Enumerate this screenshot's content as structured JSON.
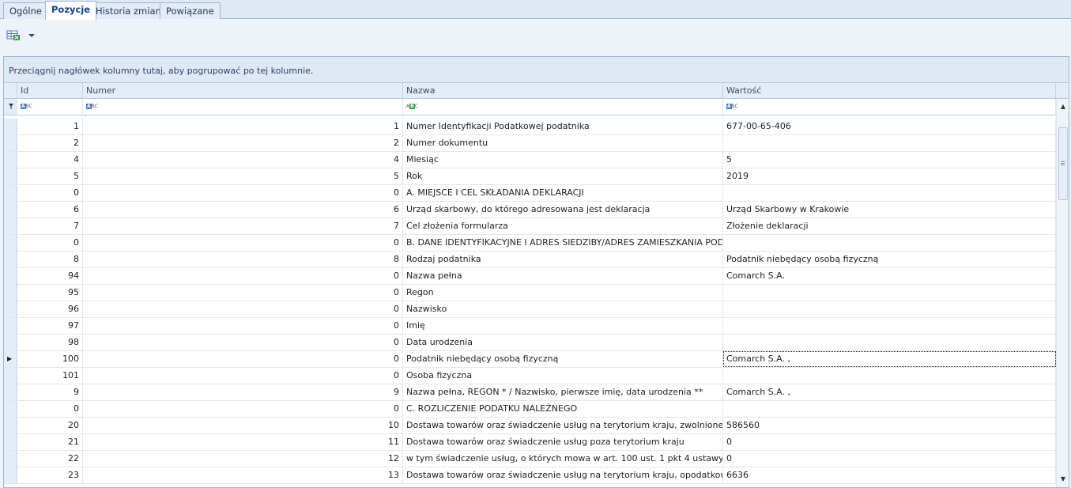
{
  "tabs": [
    {
      "label": "Ogólne"
    },
    {
      "label": "Pozycje"
    },
    {
      "label": "Historia zmian"
    },
    {
      "label": "Powiązane"
    }
  ],
  "toolbar": {
    "export_icon": "export-to-excel-icon",
    "dropdown_icon": "chevron-down-icon"
  },
  "grid": {
    "group_panel_text": "Przeciągnij nagłówek kolumny tutaj, aby pogrupować po tej kolumnie.",
    "columns": {
      "id": "Id",
      "numer": "Numer",
      "nazwa": "Nazwa",
      "wartosc": "Wartość"
    },
    "rows": [
      {
        "id": "1",
        "numer": "1",
        "nazwa": "Numer Identyfikacji Podatkowej podatnika",
        "wartosc": "677-00-65-406"
      },
      {
        "id": "2",
        "numer": "2",
        "nazwa": "Numer dokumentu",
        "wartosc": ""
      },
      {
        "id": "4",
        "numer": "4",
        "nazwa": "Miesiąc",
        "wartosc": "5"
      },
      {
        "id": "5",
        "numer": "5",
        "nazwa": "Rok",
        "wartosc": "2019"
      },
      {
        "id": "0",
        "numer": "0",
        "nazwa": "A. MIEJSCE I CEL SKŁADANIA DEKLARACJI",
        "wartosc": ""
      },
      {
        "id": "6",
        "numer": "6",
        "nazwa": "Urząd skarbowy, do którego adresowana jest deklaracja",
        "wartosc": "Urząd Skarbowy w Krakowie"
      },
      {
        "id": "7",
        "numer": "7",
        "nazwa": "Cel złożenia formularza",
        "wartosc": "Złożenie deklaracji"
      },
      {
        "id": "0",
        "numer": "0",
        "nazwa": "B. DANE IDENTYFIKACYJNE I ADRES SIEDZIBY/ADRES ZAMIESZKANIA PODATNI...",
        "wartosc": ""
      },
      {
        "id": "8",
        "numer": "8",
        "nazwa": "Rodzaj podatnika",
        "wartosc": "Podatnik niebędący osobą fizyczną"
      },
      {
        "id": "94",
        "numer": "0",
        "nazwa": "Nazwa pełna",
        "wartosc": "Comarch S.A."
      },
      {
        "id": "95",
        "numer": "0",
        "nazwa": "Regon",
        "wartosc": ""
      },
      {
        "id": "96",
        "numer": "0",
        "nazwa": "Nazwisko",
        "wartosc": ""
      },
      {
        "id": "97",
        "numer": "0",
        "nazwa": "Imię",
        "wartosc": ""
      },
      {
        "id": "98",
        "numer": "0",
        "nazwa": "Data urodzenia",
        "wartosc": ""
      },
      {
        "id": "100",
        "numer": "0",
        "nazwa": "Podatnik niebędący osobą fizyczną",
        "wartosc": "Comarch S.A. ,"
      },
      {
        "id": "101",
        "numer": "0",
        "nazwa": "Osoba fizyczna",
        "wartosc": ""
      },
      {
        "id": "9",
        "numer": "9",
        "nazwa": "Nazwa pełna, REGON * / Nazwisko, pierwsze imię, data  urodzenia **",
        "wartosc": "Comarch S.A. ,"
      },
      {
        "id": "0",
        "numer": "0",
        "nazwa": "C. ROZLICZENIE PODATKU NALEŻNEGO",
        "wartosc": ""
      },
      {
        "id": "20",
        "numer": "10",
        "nazwa": "Dostawa towarów oraz świadczenie usług na terytorium kraju, zwolnione o...",
        "wartosc": "586560"
      },
      {
        "id": "21",
        "numer": "11",
        "nazwa": "Dostawa towarów oraz świadczenie usług poza terytorium  kraju",
        "wartosc": "0"
      },
      {
        "id": "22",
        "numer": "12",
        "nazwa": "w tym świadczenie usług, o których mowa w art. 100 ust. 1 pkt 4 ustawy",
        "wartosc": "0"
      },
      {
        "id": "23",
        "numer": "13",
        "nazwa": "Dostawa towarów oraz świadczenie usług na terytorium kraju, opodatkow...",
        "wartosc": "6636"
      }
    ]
  }
}
